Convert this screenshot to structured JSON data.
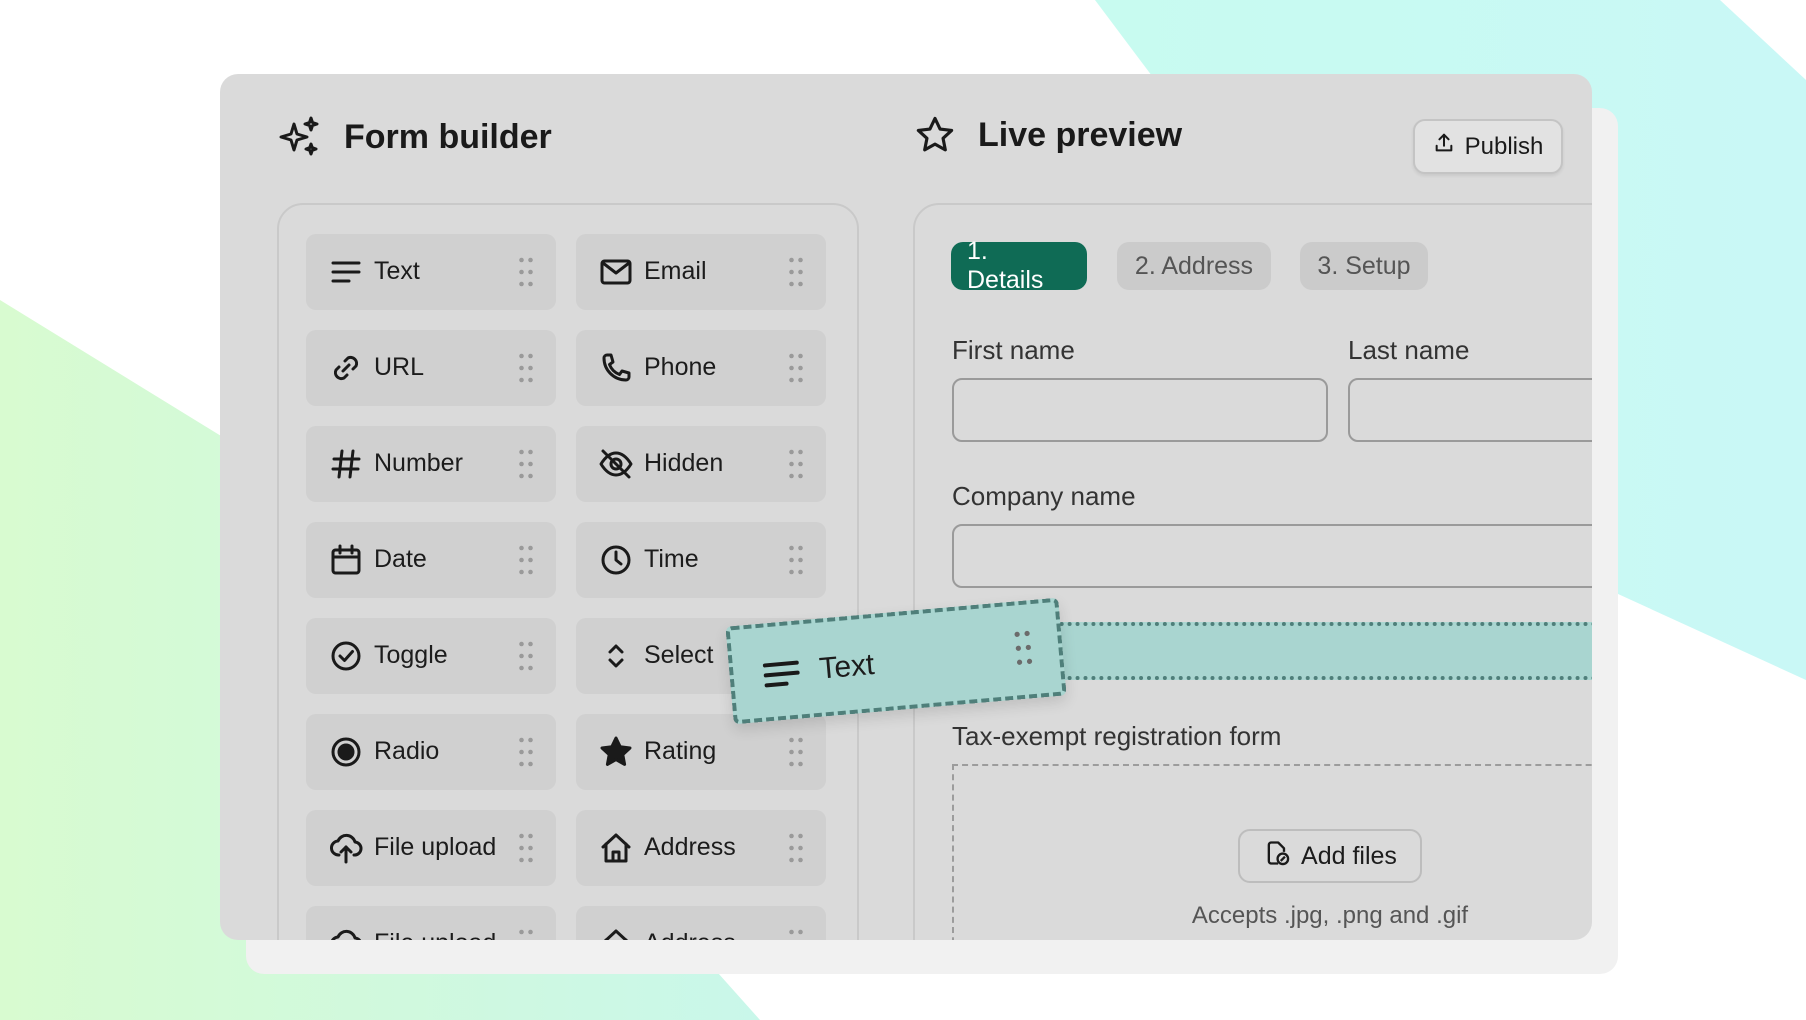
{
  "colors": {
    "accent": "#0f6b55",
    "drop_highlight": "#a9d5d0",
    "panel_bg": "#dadada",
    "tile_bg": "#d0d0d0"
  },
  "builder": {
    "title": "Form builder",
    "title_icon": "sparkles-icon",
    "fields": [
      {
        "label": "Text",
        "icon": "text-lines-icon"
      },
      {
        "label": "Email",
        "icon": "envelope-icon"
      },
      {
        "label": "URL",
        "icon": "link-icon"
      },
      {
        "label": "Phone",
        "icon": "phone-icon"
      },
      {
        "label": "Number",
        "icon": "hash-icon"
      },
      {
        "label": "Hidden",
        "icon": "eye-off-icon"
      },
      {
        "label": "Date",
        "icon": "calendar-icon"
      },
      {
        "label": "Time",
        "icon": "clock-icon"
      },
      {
        "label": "Toggle",
        "icon": "check-circle-icon"
      },
      {
        "label": "Select",
        "icon": "chevrons-up-down-icon"
      },
      {
        "label": "Radio",
        "icon": "radio-icon"
      },
      {
        "label": "Rating",
        "icon": "star-filled-icon"
      },
      {
        "label": "File upload",
        "icon": "cloud-upload-icon"
      },
      {
        "label": "Address",
        "icon": "home-icon"
      },
      {
        "label": "File upload",
        "icon": "cloud-upload-icon"
      },
      {
        "label": "Address",
        "icon": "home-icon"
      }
    ]
  },
  "preview": {
    "title": "Live preview",
    "title_icon": "star-outline-icon",
    "publish_label": "Publish",
    "steps": [
      "1. Details",
      "2. Address",
      "3. Setup"
    ],
    "active_step": 0,
    "first_name_label": "First name",
    "last_name_label": "Last name",
    "company_label": "Company name",
    "tax_label": "Tax-exempt registration form",
    "add_files_label": "Add files",
    "accepts_text": "Accepts .jpg, .png and .gif"
  },
  "drag": {
    "label": "Text",
    "icon": "text-lines-icon"
  }
}
